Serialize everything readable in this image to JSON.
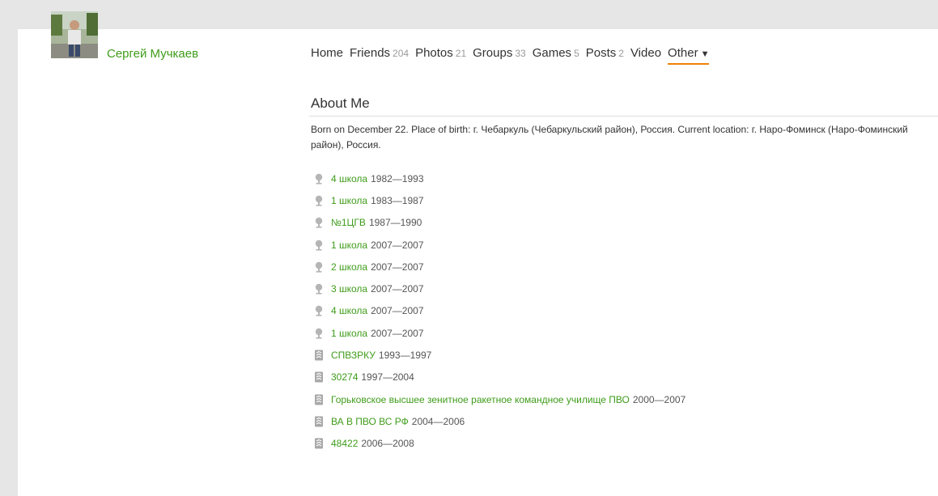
{
  "profile": {
    "name": "Сергей Мучкаев"
  },
  "nav": {
    "home": "Home",
    "friends": {
      "label": "Friends",
      "count": "204"
    },
    "photos": {
      "label": "Photos",
      "count": "21"
    },
    "groups": {
      "label": "Groups",
      "count": "33"
    },
    "games": {
      "label": "Games",
      "count": "5"
    },
    "posts": {
      "label": "Posts",
      "count": "2"
    },
    "video": "Video",
    "other": "Other",
    "other_arrow": "▼"
  },
  "about": {
    "title": "About Me",
    "bio": "Born on December 22. Place of birth: г. Чебаркуль (Чебаркульский район), Россия. Current location: г. Наро-Фоминск (Наро-Фоминский район), Россия."
  },
  "education": [
    {
      "icon": "school-icon",
      "name": "4 школа",
      "years": "1982—1993"
    },
    {
      "icon": "school-icon",
      "name": "1 школа",
      "years": "1983—1987"
    },
    {
      "icon": "school-icon",
      "name": "№1ЦГВ",
      "years": "1987—1990"
    },
    {
      "icon": "school-icon",
      "name": "1 школа",
      "years": "2007—2007"
    },
    {
      "icon": "school-icon",
      "name": "2 школа",
      "years": "2007—2007"
    },
    {
      "icon": "school-icon",
      "name": "3 школа",
      "years": "2007—2007"
    },
    {
      "icon": "school-icon",
      "name": "4 школа",
      "years": "2007—2007"
    },
    {
      "icon": "school-icon",
      "name": "1 школа",
      "years": "2007—2007"
    },
    {
      "icon": "military-icon",
      "name": "СПВЗРКУ",
      "years": "1993—1997"
    },
    {
      "icon": "military-icon",
      "name": "30274",
      "years": "1997—2004"
    },
    {
      "icon": "military-icon",
      "name": "Горьковское высшее зенитное ракетное командное училище ПВО",
      "years": "2000—2007"
    },
    {
      "icon": "military-icon",
      "name": "ВА В ПВО ВС РФ",
      "years": "2004—2006"
    },
    {
      "icon": "military-icon",
      "name": "48422",
      "years": "2006—2008"
    }
  ],
  "colors": {
    "link_green": "#3e9c1a",
    "active_underline": "#ee8208"
  }
}
